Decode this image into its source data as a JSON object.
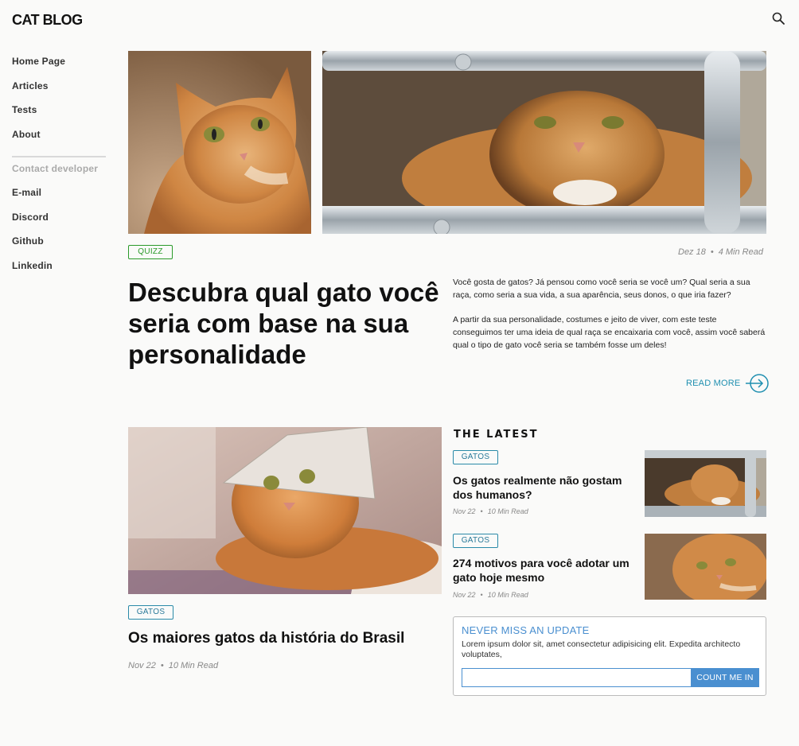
{
  "header": {
    "logo": "CAT BLOG",
    "search_icon": "search-icon"
  },
  "sidebar": {
    "nav": [
      "Home Page",
      "Articles",
      "Tests",
      "About"
    ],
    "contact_heading": "Contact developer",
    "contacts": [
      "E-mail",
      "Discord",
      "Github",
      "Linkedin"
    ]
  },
  "hero": {
    "tag": "QUIZZ",
    "date": "Dez 18",
    "read_time": "4 Min Read",
    "title": "Descubra qual gato você seria com base na sua personalidade",
    "paragraph1": "Você gosta de gatos? Já pensou como você seria se você um? Qual seria a sua raça, como seria a sua vida, a sua aparência, seus donos, o que iria fazer?",
    "paragraph2": "A partir da sua personalidade, costumes e jeito de viver, com este teste conseguimos ter uma ideia de qual raça se encaixaria com você, assim você saberá qual o tipo de gato você seria se também fosse um deles!",
    "read_more": "READ MORE",
    "read_more_icon": "arrow-right-circle-icon"
  },
  "featured": {
    "tag": "GATOS",
    "title": "Os maiores gatos da história do Brasil",
    "date": "Nov 22",
    "read_time": "10 Min Read"
  },
  "latest": {
    "heading": "THE LATEST",
    "items": [
      {
        "tag": "GATOS",
        "title": "Os gatos realmente não gostam dos humanos?",
        "date": "Nov 22",
        "read_time": "10 Min Read"
      },
      {
        "tag": "GATOS",
        "title": "274 motivos para você adotar um gato hoje mesmo",
        "date": "Nov 22",
        "read_time": "10 Min Read"
      }
    ]
  },
  "newsletter": {
    "title": "NEVER MISS AN UPDATE",
    "text": "Lorem ipsum dolor sit, amet consectetur adipisicing elit. Expedita architecto voluptates,",
    "input_value": "",
    "button": "COUNT ME IN"
  },
  "colors": {
    "background": "#fafaf9",
    "quizz_tag": "#2a9a2a",
    "gatos_tag": "#2a8aa8",
    "read_more": "#1f8fb0",
    "newsletter_accent": "#4a8fd0"
  }
}
